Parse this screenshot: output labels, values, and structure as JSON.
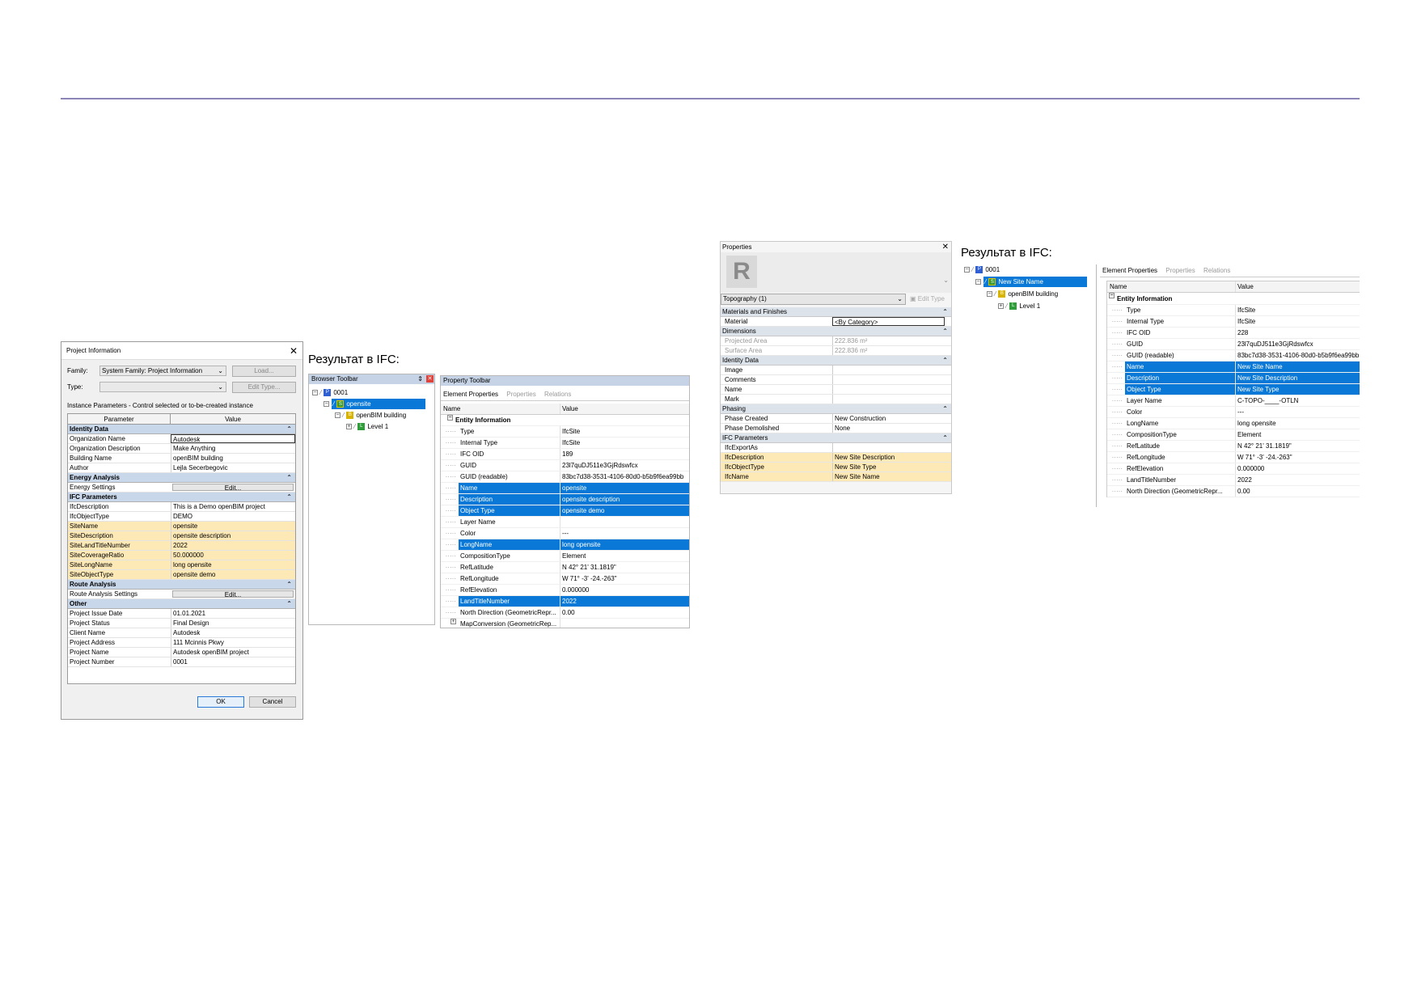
{
  "headings": {
    "ifc_result_1": "Результат в IFC:",
    "ifc_result_2": "Результат в IFC:"
  },
  "project_info": {
    "title": "Project Information",
    "family_label": "Family:",
    "family_value": "System Family: Project Information",
    "type_label": "Type:",
    "type_value": "",
    "load_button": "Load...",
    "edit_type_button": "Edit Type...",
    "instance_text": "Instance Parameters - Control selected or to-be-created instance",
    "col_parameter": "Parameter",
    "col_value": "Value",
    "groups": [
      {
        "name": "Identity Data",
        "rows": [
          {
            "p": "Organization Name",
            "v": "Autodesk",
            "hl": false
          },
          {
            "p": "Organization Description",
            "v": "Make Anything",
            "hl": false
          },
          {
            "p": "Building Name",
            "v": "openBIM building",
            "hl": false
          },
          {
            "p": "Author",
            "v": "Lejla Secerbegovic",
            "hl": false
          }
        ]
      },
      {
        "name": "Energy Analysis",
        "rows": [
          {
            "p": "Energy Settings",
            "v": "Edit...",
            "btn": true
          }
        ]
      },
      {
        "name": "IFC Parameters",
        "rows": [
          {
            "p": "IfcDescription",
            "v": "This is a Demo openBIM project",
            "hl": false
          },
          {
            "p": "IfcObjectType",
            "v": "DEMO",
            "hl": false
          },
          {
            "p": "SiteName",
            "v": "opensite",
            "hl": true
          },
          {
            "p": "SiteDescription",
            "v": "opensite description",
            "hl": true
          },
          {
            "p": "SiteLandTitleNumber",
            "v": "2022",
            "hl": true
          },
          {
            "p": "SiteCoverageRatio",
            "v": "50.000000",
            "hl": true
          },
          {
            "p": "SiteLongName",
            "v": "long opensite",
            "hl": true
          },
          {
            "p": "SiteObjectType",
            "v": "opensite demo",
            "hl": true
          }
        ]
      },
      {
        "name": "Route Analysis",
        "rows": [
          {
            "p": "Route Analysis Settings",
            "v": "Edit...",
            "btn": true
          }
        ]
      },
      {
        "name": "Other",
        "rows": [
          {
            "p": "Project Issue Date",
            "v": "01.01.2021",
            "hl": false
          },
          {
            "p": "Project Status",
            "v": "Final Design",
            "hl": false
          },
          {
            "p": "Client Name",
            "v": "Autodesk",
            "hl": false
          },
          {
            "p": "Project Address",
            "v": "111 Mcinnis Pkwy",
            "hl": false
          },
          {
            "p": "Project Name",
            "v": "Autodesk openBIM project",
            "hl": false
          },
          {
            "p": "Project Number",
            "v": "0001",
            "hl": false
          }
        ]
      }
    ],
    "ok_button": "OK",
    "cancel_button": "Cancel"
  },
  "browser_toolbar": {
    "title": "Browser Toolbar",
    "project": "0001",
    "site": "opensite",
    "building": "openBIM building",
    "level": "Level 1"
  },
  "property_toolbar_1": {
    "title": "Property Toolbar",
    "tabs": [
      "Element Properties",
      "Properties",
      "Relations"
    ],
    "col_name": "Name",
    "col_value": "Value",
    "group": "Entity Information",
    "rows": [
      {
        "n": "Type",
        "v": "IfcSite",
        "sel": false
      },
      {
        "n": "Internal Type",
        "v": "IfcSite",
        "sel": false
      },
      {
        "n": "IFC OID",
        "v": "189",
        "sel": false
      },
      {
        "n": "GUID",
        "v": "23l7quDJ511e3GjRdswfcx",
        "sel": false
      },
      {
        "n": "GUID (readable)",
        "v": "83bc7d38-3531-4106-80d0-b5b9f6ea99bb",
        "sel": false
      },
      {
        "n": "Name",
        "v": "opensite",
        "sel": true
      },
      {
        "n": "Description",
        "v": "opensite description",
        "sel": true
      },
      {
        "n": "Object Type",
        "v": "opensite demo",
        "sel": true
      },
      {
        "n": "Layer Name",
        "v": "",
        "sel": false
      },
      {
        "n": "Color",
        "v": "---",
        "sel": false
      },
      {
        "n": "LongName",
        "v": "long opensite",
        "sel": true
      },
      {
        "n": "CompositionType",
        "v": "Element",
        "sel": false
      },
      {
        "n": "RefLatitude",
        "v": "N 42° 21' 31.1819\"",
        "sel": false
      },
      {
        "n": "RefLongitude",
        "v": "W 71° -3' -24.-263\"",
        "sel": false
      },
      {
        "n": "RefElevation",
        "v": "0.000000",
        "sel": false
      },
      {
        "n": "LandTitleNumber",
        "v": "2022",
        "sel": true
      },
      {
        "n": "North Direction (GeometricRepr...",
        "v": "0.00",
        "sel": false
      },
      {
        "n": "MapConversion (GeometricRep...",
        "v": "",
        "sel": false,
        "expand": true
      }
    ]
  },
  "revit_properties": {
    "title": "Properties",
    "type_selector": "Topography (1)",
    "edit_type": "Edit Type",
    "groups": [
      {
        "name": "Materials and Finishes",
        "rows": [
          {
            "p": "Material",
            "v": "<By Category>",
            "box": true
          }
        ]
      },
      {
        "name": "Dimensions",
        "rows": [
          {
            "p": "Projected Area",
            "v": "222.836 m²",
            "dim": true
          },
          {
            "p": "Surface Area",
            "v": "222.836 m²",
            "dim": true
          }
        ]
      },
      {
        "name": "Identity Data",
        "rows": [
          {
            "p": "Image",
            "v": ""
          },
          {
            "p": "Comments",
            "v": ""
          },
          {
            "p": "Name",
            "v": ""
          },
          {
            "p": "Mark",
            "v": ""
          }
        ]
      },
      {
        "name": "Phasing",
        "rows": [
          {
            "p": "Phase Created",
            "v": "New Construction"
          },
          {
            "p": "Phase Demolished",
            "v": "None"
          }
        ]
      },
      {
        "name": "IFC Parameters",
        "rows": [
          {
            "p": "IfcExportAs",
            "v": ""
          },
          {
            "p": "IfcDescription",
            "v": "New Site Description",
            "hl": true
          },
          {
            "p": "IfcObjectType",
            "v": "New Site Type",
            "hl": true
          },
          {
            "p": "IfcName",
            "v": "New Site Name",
            "hl": true
          }
        ]
      }
    ]
  },
  "browser_tree_2": {
    "project": "0001",
    "site": "New Site Name",
    "building": "openBIM building",
    "level": "Level 1"
  },
  "property_toolbar_2": {
    "tabs": [
      "Element Properties",
      "Properties",
      "Relations"
    ],
    "col_name": "Name",
    "col_value": "Value",
    "group": "Entity Information",
    "rows": [
      {
        "n": "Type",
        "v": "IfcSite",
        "sel": false
      },
      {
        "n": "Internal Type",
        "v": "IfcSite",
        "sel": false
      },
      {
        "n": "IFC OID",
        "v": "228",
        "sel": false
      },
      {
        "n": "GUID",
        "v": "23l7quDJ511e3GjRdswfcx",
        "sel": false
      },
      {
        "n": "GUID (readable)",
        "v": "83bc7d38-3531-4106-80d0-b5b9f6ea99bb",
        "sel": false
      },
      {
        "n": "Name",
        "v": "New Site Name",
        "sel": true
      },
      {
        "n": "Description",
        "v": "New Site Description",
        "sel": true
      },
      {
        "n": "Object Type",
        "v": "New Site Type",
        "sel": true
      },
      {
        "n": "Layer Name",
        "v": "C-TOPO-____-OTLN",
        "sel": false
      },
      {
        "n": "Color",
        "v": "---",
        "sel": false
      },
      {
        "n": "LongName",
        "v": "long opensite",
        "sel": false
      },
      {
        "n": "CompositionType",
        "v": "Element",
        "sel": false
      },
      {
        "n": "RefLatitude",
        "v": "N 42° 21' 31.1819\"",
        "sel": false
      },
      {
        "n": "RefLongitude",
        "v": "W 71° -3' -24.-263\"",
        "sel": false
      },
      {
        "n": "RefElevation",
        "v": "0.000000",
        "sel": false
      },
      {
        "n": "LandTitleNumber",
        "v": "2022",
        "sel": false
      },
      {
        "n": "North Direction (GeometricRepr...",
        "v": "0.00",
        "sel": false
      }
    ]
  },
  "colors": {
    "selection": "#0a78d7",
    "highlight": "#fde9b6",
    "rule": "#8b85b8"
  }
}
